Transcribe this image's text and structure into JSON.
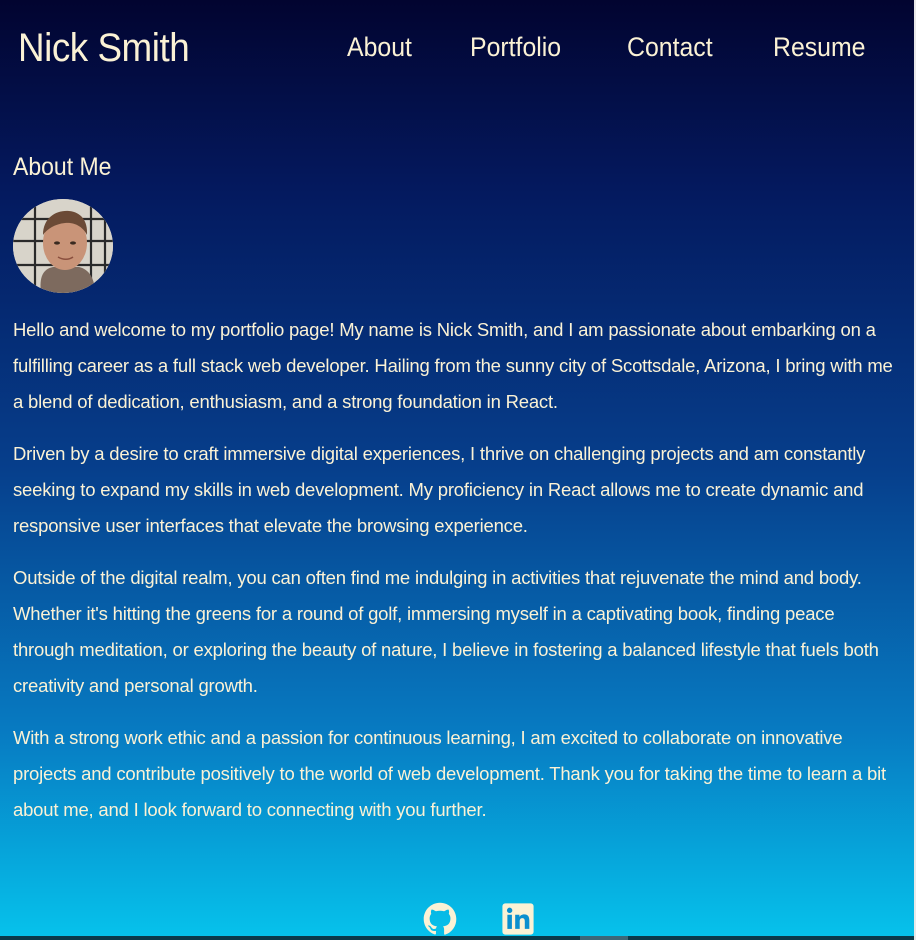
{
  "header": {
    "brand": "Nick Smith",
    "nav": [
      {
        "label": "About"
      },
      {
        "label": "Portfolio"
      },
      {
        "label": "Contact"
      },
      {
        "label": "Resume"
      }
    ]
  },
  "about": {
    "title": "About Me",
    "avatar_icon": "profile-photo",
    "paragraphs": [
      "Hello and welcome to my portfolio page! My name is Nick Smith, and I am passionate about embarking on a fulfilling career as a full stack web developer. Hailing from the sunny city of Scottsdale, Arizona, I bring with me a blend of dedication, enthusiasm, and a strong foundation in React.",
      "Driven by a desire to craft immersive digital experiences, I thrive on challenging projects and am constantly seeking to expand my skills in web development. My proficiency in React allows me to create dynamic and responsive user interfaces that elevate the browsing experience.",
      "Outside of the digital realm, you can often find me indulging in activities that rejuvenate the mind and body. Whether it's hitting the greens for a round of golf, immersing myself in a captivating book, finding peace through meditation, or exploring the beauty of nature, I believe in fostering a balanced lifestyle that fuels both creativity and personal growth.",
      "With a strong work ethic and a passion for continuous learning, I am excited to collaborate on innovative projects and contribute positively to the world of web development. Thank you for taking the time to learn a bit about me, and I look forward to connecting with you further."
    ]
  },
  "footer": {
    "icons": [
      "github-icon",
      "linkedin-icon"
    ]
  },
  "colors": {
    "text": "#fbf2d5",
    "gradient_top": "#020430",
    "gradient_bottom": "#06c3ec"
  }
}
